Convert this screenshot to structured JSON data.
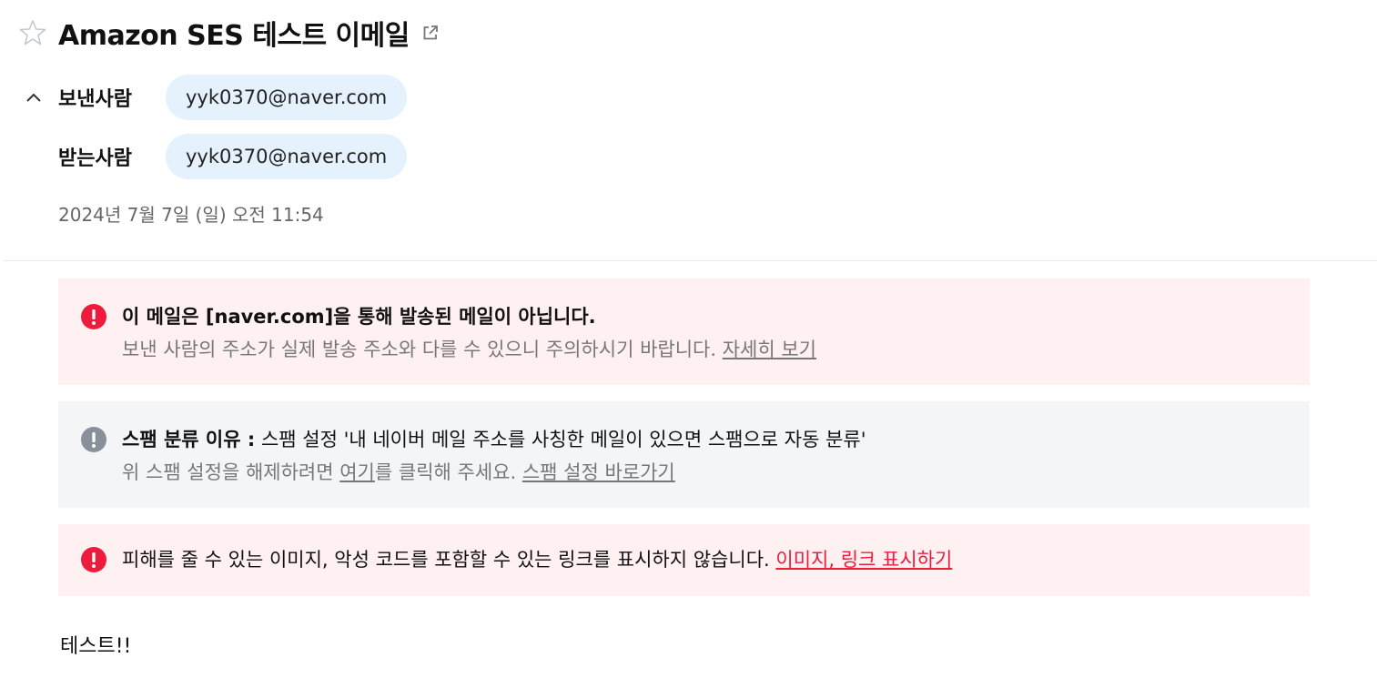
{
  "subject": "Amazon SES 테스트 이메일",
  "sender": {
    "label": "보낸사람",
    "address": "yyk0370@naver.com"
  },
  "recipient": {
    "label": "받는사람",
    "address": "yyk0370@naver.com"
  },
  "date": "2024년 7월 7일 (일) 오전 11:54",
  "notices": {
    "sender_warning": {
      "title": "이 메일은 [naver.com]을 통해 발송된 메일이 아닙니다.",
      "sub": "보낸 사람의 주소가 실제 발송 주소와 다를 수 있으니 주의하시기 바랍니다.",
      "link": "자세히 보기"
    },
    "spam_reason": {
      "title": "스팸 분류 이유 :",
      "reason": "스팸 설정 '내 네이버 메일 주소를 사칭한 메일이 있으면 스팸으로 자동 분류'",
      "sub_prefix": "위 스팸 설정을 해제하려면",
      "here_link": "여기",
      "sub_suffix": "를 클릭해 주세요.",
      "settings_link": "스팸 설정 바로가기"
    },
    "content_block": {
      "text": "피해를 줄 수 있는 이미지, 악성 코드를 포함할 수 있는 링크를 표시하지 않습니다.",
      "link": "이미지, 링크 표시하기"
    }
  },
  "body": "테스트!!",
  "colors": {
    "warning_red": "#ee1b3c",
    "info_gray": "#8a8f9c",
    "chip_blue": "#e5f1fd",
    "red_box": "#fff0f2",
    "gray_box": "#f4f5f7"
  },
  "icons": {
    "star": "star-outline-icon",
    "external": "open-new-window-icon",
    "collapse": "chevron-up-icon",
    "warning": "exclamation-circle-icon"
  }
}
